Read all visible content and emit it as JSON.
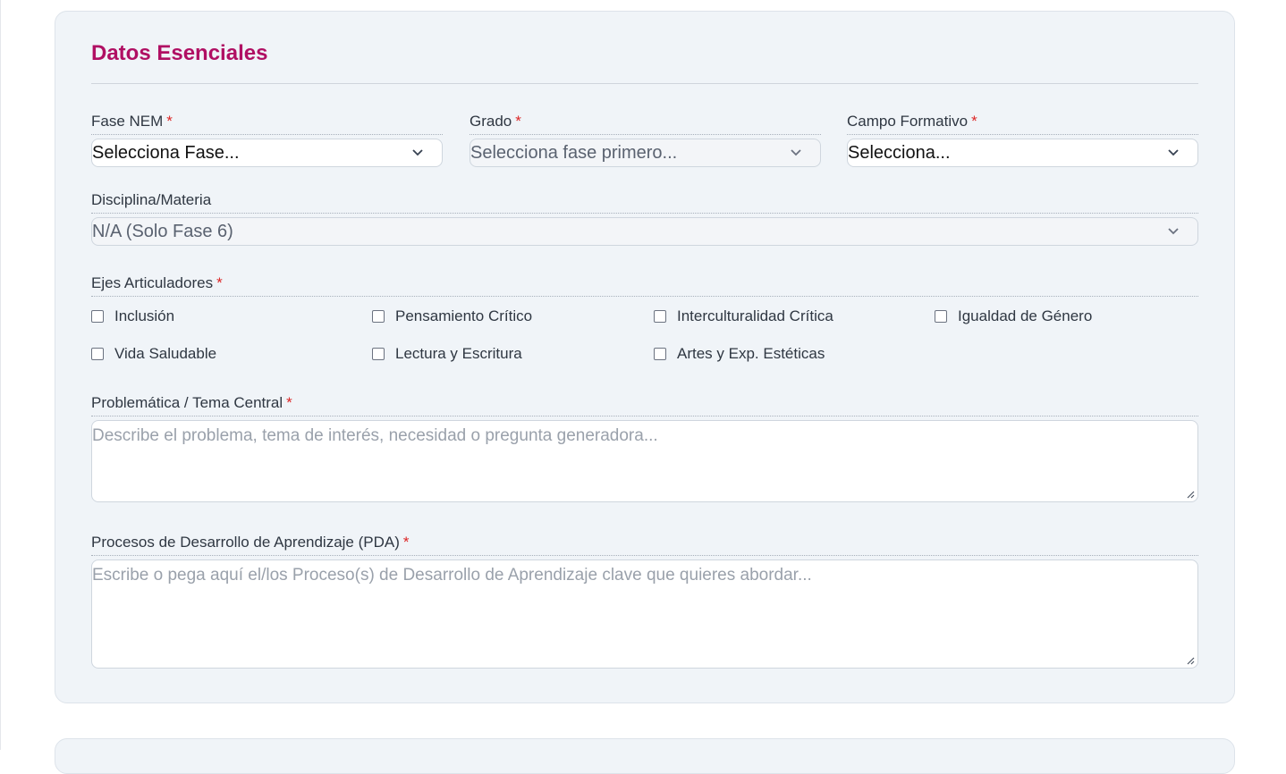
{
  "section": {
    "title": "Datos Esenciales"
  },
  "fields": {
    "fase": {
      "label": "Fase NEM",
      "required_mark": "*",
      "value": "Selecciona Fase..."
    },
    "grado": {
      "label": "Grado",
      "required_mark": "*",
      "value": "Selecciona fase primero..."
    },
    "campo": {
      "label": "Campo Formativo",
      "required_mark": "*",
      "value": "Selecciona..."
    },
    "disciplina": {
      "label": "Disciplina/Materia",
      "value": "N/A (Solo Fase 6)"
    },
    "ejes": {
      "label": "Ejes Articuladores",
      "required_mark": "*",
      "options": [
        {
          "label": "Inclusión",
          "checked": false
        },
        {
          "label": "Pensamiento Crítico",
          "checked": false
        },
        {
          "label": "Interculturalidad Crítica",
          "checked": false
        },
        {
          "label": "Igualdad de Género",
          "checked": false
        },
        {
          "label": "Vida Saludable",
          "checked": false
        },
        {
          "label": "Lectura y Escritura",
          "checked": false
        },
        {
          "label": "Artes y Exp. Estéticas",
          "checked": false
        }
      ]
    },
    "problematica": {
      "label": "Problemática / Tema Central",
      "required_mark": "*",
      "placeholder": "Describe el problema, tema de interés, necesidad o pregunta generadora..."
    },
    "pda": {
      "label": "Procesos de Desarrollo de Aprendizaje (PDA)",
      "required_mark": "*",
      "placeholder": "Escribe o pega aquí el/los Proceso(s) de Desarrollo de Aprendizaje clave que quieres abordar..."
    }
  },
  "colors": {
    "title": "#b00f63",
    "required": "#dc2626",
    "card_bg": "#f0f4f8"
  }
}
